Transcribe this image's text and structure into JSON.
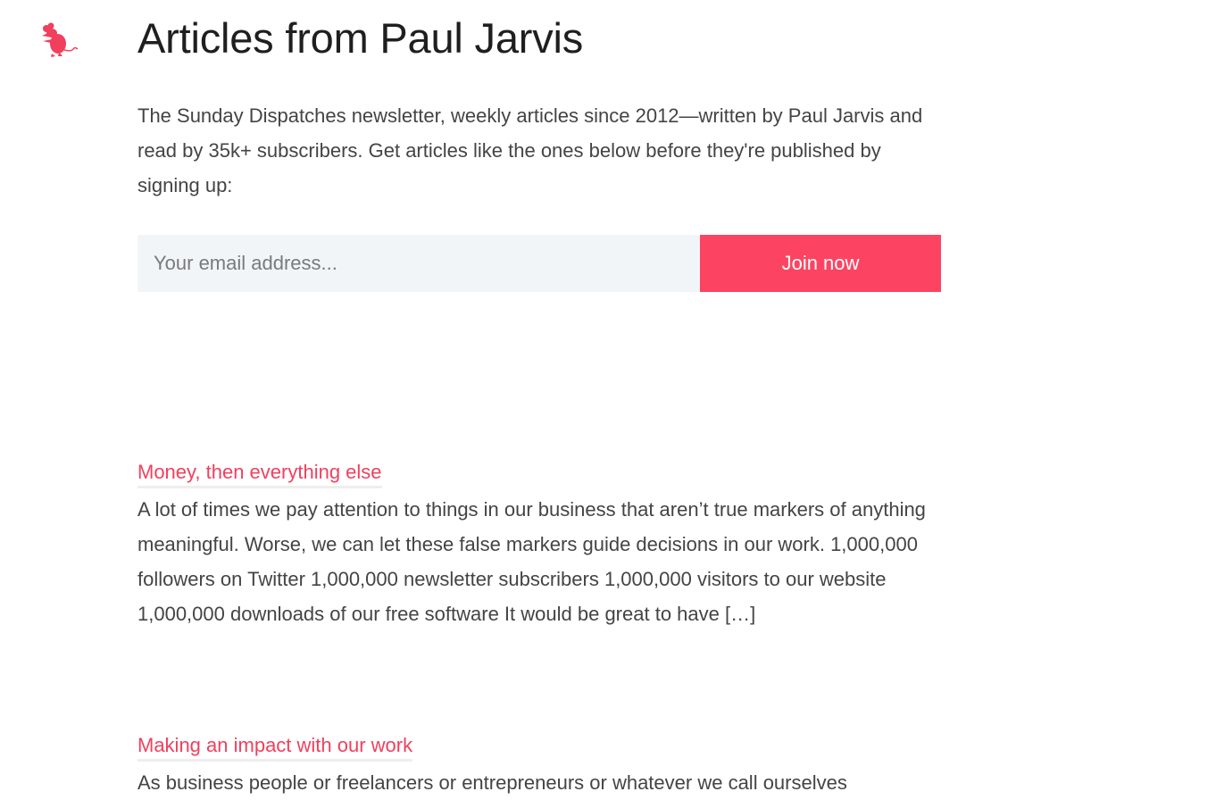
{
  "logo": {
    "icon": "rat-icon",
    "color": "#f0405e"
  },
  "header": {
    "title": "Articles from Paul Jarvis"
  },
  "intro": {
    "text": "The Sunday Dispatches newsletter, weekly articles since 2012—written by Paul Jarvis and read by 35k+ subscribers. Get articles like the ones below before they're published by signing up:"
  },
  "signup": {
    "email_placeholder": "Your email address...",
    "email_value": "",
    "button_label": "Join now"
  },
  "articles": [
    {
      "title": "Money, then everything else",
      "excerpt": "A lot of times we pay attention to things in our business that aren’t true markers of anything meaningful. Worse, we can let these false markers guide decisions in our work. 1,000,000 followers on Twitter 1,000,000 newsletter subscribers 1,000,000 visitors to our website 1,000,000 downloads of our free software It would be great to have […]"
    },
    {
      "title": "Making an impact with our work",
      "excerpt": "As business people or freelancers or entrepreneurs or whatever we call ourselves"
    }
  ],
  "colors": {
    "accent": "#fc4462",
    "link": "#f0405e",
    "input_bg": "#f2f5f8"
  }
}
